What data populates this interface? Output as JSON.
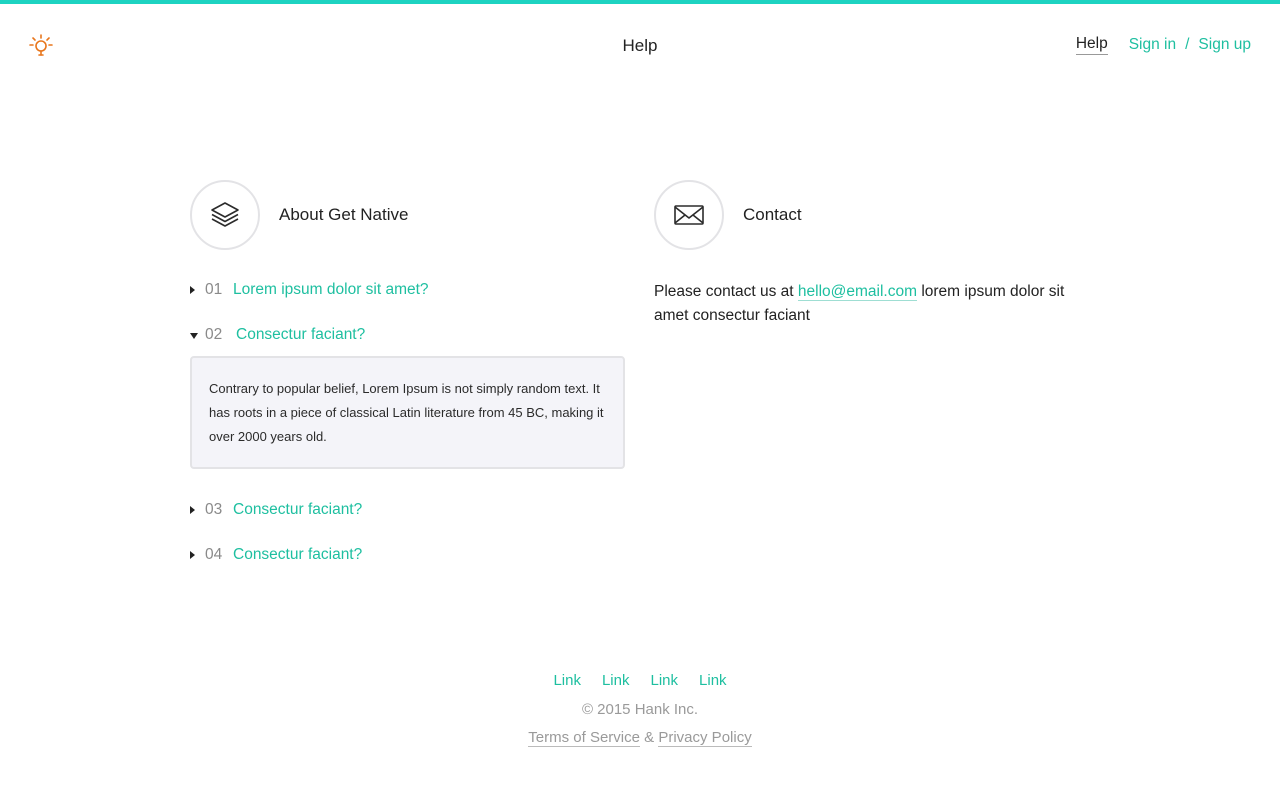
{
  "header": {
    "logo_icon": "lightbulb-icon",
    "title": "Help",
    "nav": {
      "help": "Help",
      "sign_in": "Sign in",
      "separator": "/",
      "sign_up": "Sign up"
    }
  },
  "colors": {
    "accent": "#1ebfa0",
    "top_bar": "#1dd3c1",
    "logo": "#e8761c",
    "answer_bg": "#f4f4f9"
  },
  "about": {
    "icon": "layers-icon",
    "title": "About Get Native",
    "faq": [
      {
        "num": "01",
        "question": "Lorem ipsum dolor sit amet?",
        "expanded": false
      },
      {
        "num": "02",
        "question": "Consectur faciant?",
        "expanded": true,
        "answer": "Contrary to popular belief, Lorem Ipsum is not simply random text. It has roots in a piece of classical Latin literature from 45 BC, making it over 2000 years old."
      },
      {
        "num": "03",
        "question": "Consectur faciant?",
        "expanded": false
      },
      {
        "num": "04",
        "question": "Consectur faciant?",
        "expanded": false
      }
    ]
  },
  "contact": {
    "icon": "envelope-icon",
    "title": "Contact",
    "text_before": "Please contact us at ",
    "email": "hello@email.com",
    "text_after": " lorem ipsum dolor sit amet consectur faciant"
  },
  "footer": {
    "links": [
      "Link",
      "Link",
      "Link",
      "Link"
    ],
    "copyright": "© 2015 Hank Inc.",
    "terms": "Terms of Service",
    "amp": "&",
    "privacy": "Privacy Policy"
  }
}
